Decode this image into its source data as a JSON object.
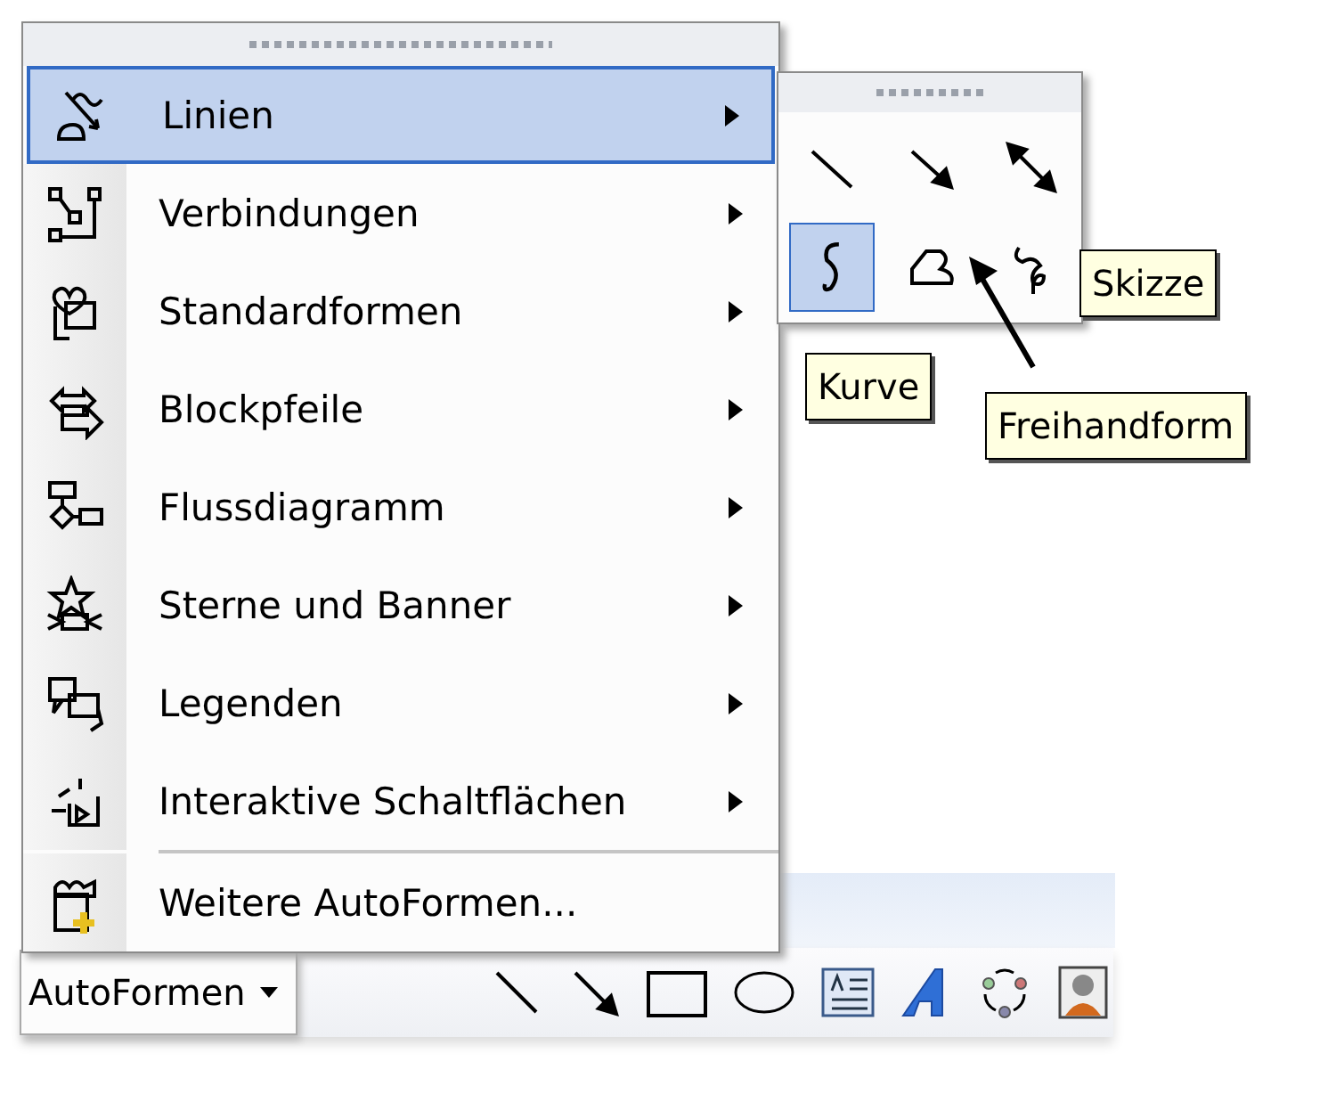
{
  "menu": {
    "items": [
      {
        "label": "Linien",
        "kind": "submenu",
        "selected": true
      },
      {
        "label": "Verbindungen",
        "kind": "submenu",
        "selected": false
      },
      {
        "label": "Standardformen",
        "kind": "submenu",
        "selected": false
      },
      {
        "label": "Blockpfeile",
        "kind": "submenu",
        "selected": false
      },
      {
        "label": "Flussdiagramm",
        "kind": "submenu",
        "selected": false
      },
      {
        "label": "Sterne und Banner",
        "kind": "submenu",
        "selected": false
      },
      {
        "label": "Legenden",
        "kind": "submenu",
        "selected": false
      },
      {
        "label": "Interaktive Schaltflächen",
        "kind": "submenu",
        "selected": false
      },
      {
        "label": "Weitere AutoFormen...",
        "kind": "command",
        "selected": false
      }
    ]
  },
  "lines_palette": {
    "tools": [
      {
        "selected": false
      },
      {
        "selected": false
      },
      {
        "selected": false
      },
      {
        "selected": true
      },
      {
        "selected": false
      },
      {
        "selected": false
      }
    ]
  },
  "tooltips": [
    "Skizze",
    "Kurve",
    "Freihandform"
  ],
  "toolbar": {
    "autoshapes_button": "AutoFormen"
  }
}
